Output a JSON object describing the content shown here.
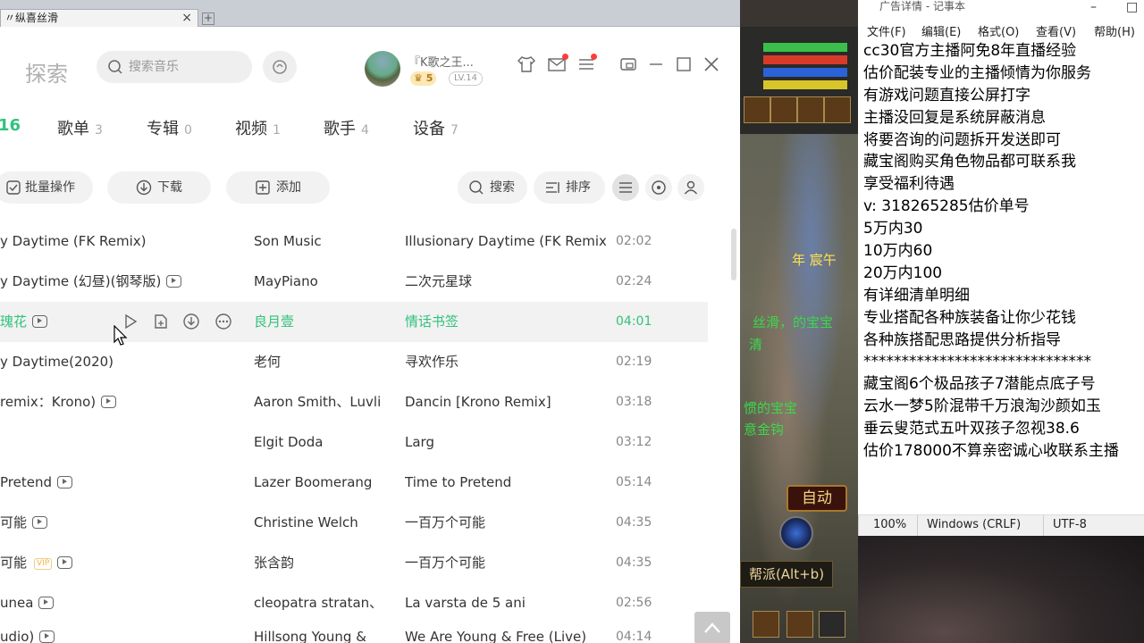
{
  "browser_tab": {
    "title": "〃纵喜丝滑",
    "close": "×",
    "new_tab": "+"
  },
  "music": {
    "explore": "探索",
    "search_placeholder": "搜索音乐",
    "user": {
      "name": "『K歌之王...",
      "vip_level": "5",
      "level": "LV.14"
    },
    "tabs": [
      {
        "label": "16",
        "count": ""
      },
      {
        "label": "歌单",
        "count": "3"
      },
      {
        "label": "专辑",
        "count": "0"
      },
      {
        "label": "视频",
        "count": "1"
      },
      {
        "label": "歌手",
        "count": "4"
      },
      {
        "label": "设备",
        "count": "7"
      }
    ],
    "toolbar": {
      "batch": "批量操作",
      "download": "下载",
      "add": "添加",
      "search": "搜索",
      "sort": "排序"
    },
    "songs": [
      {
        "title": "y Daytime (FK Remix)",
        "artist": "Son Music",
        "album": "Illusionary Daytime (FK Remix)",
        "duration": "02:02"
      },
      {
        "title": "y Daytime (幻昼)(钢琴版)",
        "artist": "MayPiano",
        "album": "二次元星球",
        "duration": "02:24"
      },
      {
        "title": "瑰花",
        "artist": "良月壹",
        "album": "情话书签",
        "duration": "04:01"
      },
      {
        "title": "y Daytime(2020)",
        "artist": "老何",
        "album": "寻欢作乐",
        "duration": "02:19"
      },
      {
        "title": "remix：Krono)",
        "artist": "Aaron Smith、Luvli",
        "album": "Dancin [Krono Remix]",
        "duration": "03:18"
      },
      {
        "title": "",
        "artist": "Elgit Doda",
        "album": "Larg",
        "duration": "03:12"
      },
      {
        "title": "Pretend",
        "artist": "Lazer Boomerang",
        "album": "Time to Pretend",
        "duration": "05:14"
      },
      {
        "title": "可能",
        "artist": "Christine Welch",
        "album": "一百万个可能",
        "duration": "04:35"
      },
      {
        "title": "可能",
        "artist": "张含韵",
        "album": "一百万个可能",
        "duration": "04:35"
      },
      {
        "title": "unea",
        "artist": "cleopatra stratan、",
        "album": "La varsta de 5 ani",
        "duration": "02:56"
      },
      {
        "title": "udio)",
        "artist": "Hillsong Young &",
        "album": "We Are Young & Free (Live)",
        "duration": "04:14"
      }
    ],
    "vip_tag": "VIP"
  },
  "game": {
    "text1": "年 宸午",
    "text2": "丝滑，的宝宝",
    "text3": "惯的宝宝",
    "text4": "意金钩",
    "text5": "清",
    "auto": "自动",
    "gang": "帮派(Alt+b)"
  },
  "notepad": {
    "title": "广告详情 - 记事本",
    "menu": [
      "文件(F)",
      "编辑(E)",
      "格式(O)",
      "查看(V)",
      "帮助(H)"
    ],
    "lines": [
      "cc30官方主播阿免8年直播经验",
      "估价配装专业的主播倾情为你服务",
      "有游戏问题直接公屏打字",
      "主播没回复是系统屏蔽消息",
      "将要咨询的问题拆开发送即可",
      "藏宝阁购买角色物品都可联系我",
      "享受福利待遇",
      "v:  318265285估价单号",
      "5万内30",
      "10万内60",
      "20万内100",
      "有详细清单明细",
      "专业搭配各种族装备让你少花钱",
      "各种族搭配思路提供分析指导",
      "******************************",
      "藏宝阁6个极品孩子7潜能点底子号",
      "云水一梦5阶混带千万浪淘沙颜如玉",
      "垂云叟范式五叶双孩子忽视38.6",
      "估价178000不算亲密诚心收联系主播"
    ],
    "status": {
      "zoom": "100%",
      "eol": "Windows (CRLF)",
      "encoding": "UTF-8"
    }
  },
  "colors": {
    "accent": "#31c27c",
    "notification": "#ff3b3b"
  }
}
